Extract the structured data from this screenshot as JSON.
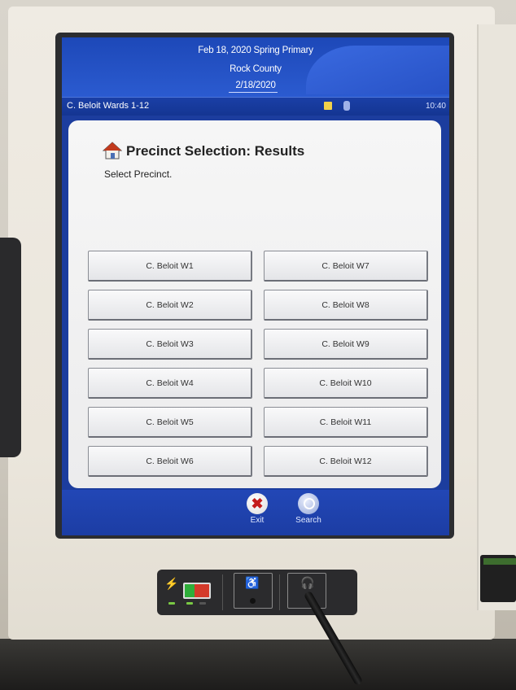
{
  "header": {
    "election": "Feb 18, 2020 Spring Primary",
    "county": "Rock County",
    "date": "2/18/2020"
  },
  "infobar": {
    "ward_label": "C. Beloit Wards 1-12",
    "clock": "10:40"
  },
  "page": {
    "title": "Precinct Selection: Results",
    "subtitle": "Select Precinct."
  },
  "precincts": [
    "C. Beloit W1",
    "C. Beloit W2",
    "C. Beloit W3",
    "C. Beloit W4",
    "C. Beloit W5",
    "C. Beloit W6",
    "C. Beloit W7",
    "C. Beloit W8",
    "C. Beloit W9",
    "C. Beloit W10",
    "C. Beloit W11",
    "C. Beloit W12"
  ],
  "footer": {
    "exit_label": "Exit",
    "search_label": "Search"
  },
  "icons": {
    "home": "house-icon",
    "exit": "close-icon",
    "search": "search-icon",
    "power": "plug-icon",
    "battery": "battery-icon",
    "accessibility": "wheelchair-icon",
    "audio": "headphones-icon"
  },
  "colors": {
    "header_blue": "#1d48b8",
    "panel_bg": "#f4f4f4",
    "exit_red": "#c41b1b",
    "led_green": "#7ac943"
  }
}
